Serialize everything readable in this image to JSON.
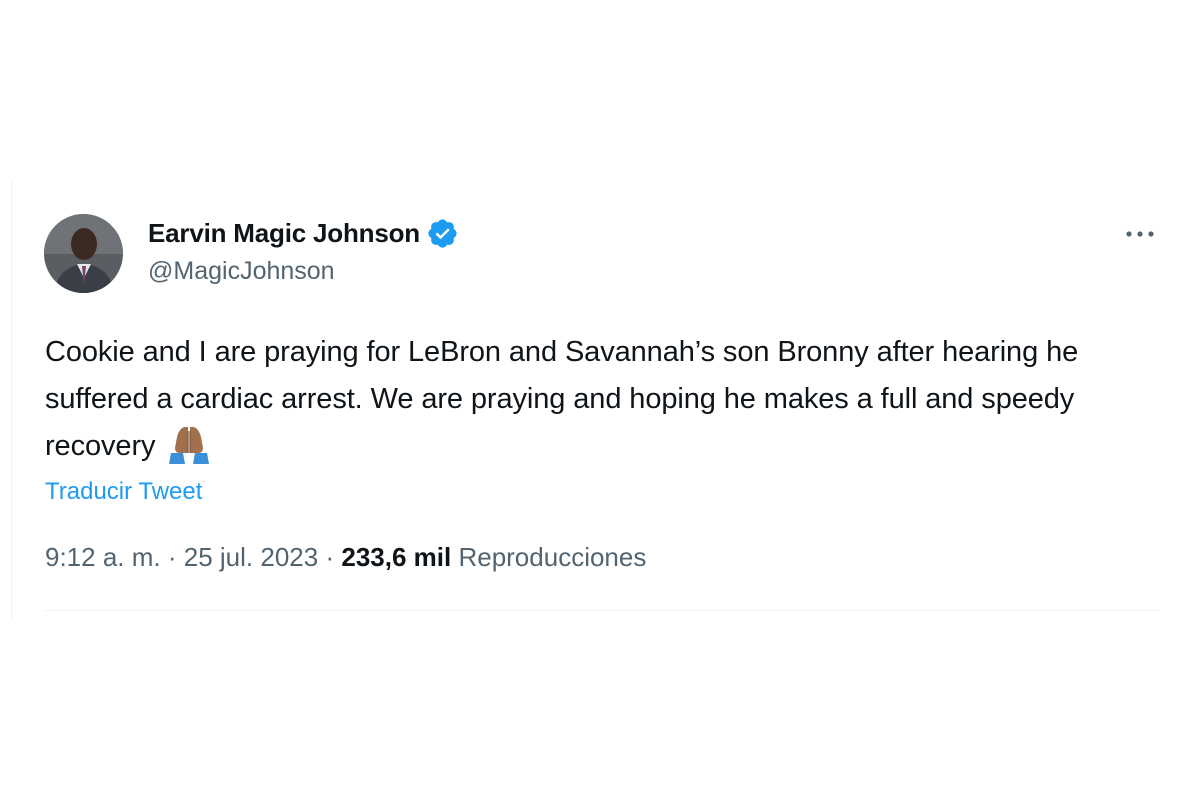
{
  "tweet": {
    "author": {
      "display_name": "Earvin Magic Johnson",
      "handle": "@MagicJohnson",
      "verified_icon": "verified-badge-icon",
      "avatar_icon": "avatar-photo"
    },
    "more_icon": "more-options-icon",
    "text": "Cookie and I are praying for LeBron and Savannah’s son Bronny after hearing he suffered a cardiac arrest. We are praying and hoping he makes a full and speedy recovery",
    "emoji": "🙏🏾",
    "translate_label": "Traducir Tweet",
    "time": "9:12 a. m.",
    "separator": "·",
    "date": "25 jul. 2023",
    "views_count": "233,6 mil",
    "views_label": "Reproducciones"
  },
  "colors": {
    "text_primary": "#0f1419",
    "text_secondary": "#536471",
    "link": "#1d9bf0",
    "verified": "#1d9bf0",
    "divider": "#eff3f4"
  }
}
